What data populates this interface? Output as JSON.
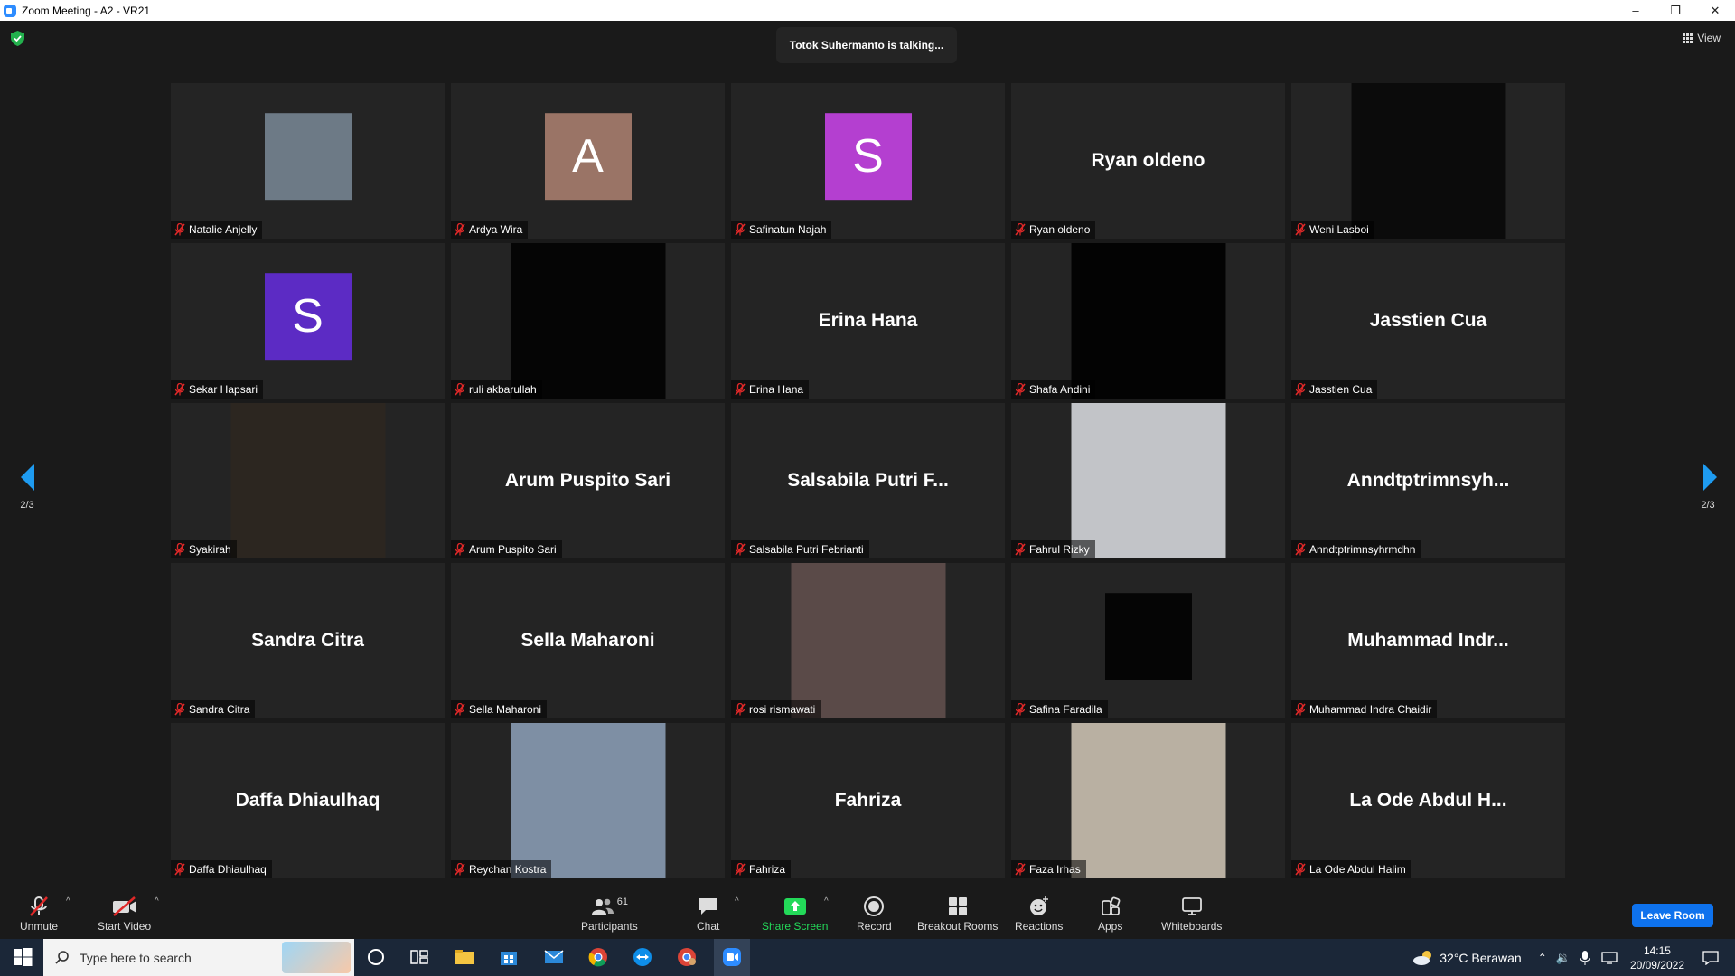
{
  "window": {
    "title": "Zoom Meeting - A2 - VR21",
    "minimize": "–",
    "restore": "❐",
    "close": "✕"
  },
  "meeting": {
    "talking": "Totok Suhermanto is talking...",
    "view_label": "View"
  },
  "pager": {
    "left": "2/3",
    "right": "2/3"
  },
  "tiles": [
    {
      "label": "Natalie Anjelly",
      "kind": "photo",
      "color": "#6d7a86"
    },
    {
      "label": "Ardya Wira",
      "kind": "avatar",
      "initial": "A",
      "color": "#9a7466"
    },
    {
      "label": "Safinatun Najah",
      "kind": "avatar",
      "initial": "S",
      "color": "#b43fd0"
    },
    {
      "label": "Ryan oldeno",
      "kind": "name",
      "name": "Ryan oldeno"
    },
    {
      "label": "Weni Lasboi",
      "kind": "video",
      "color": "#0b0b0b"
    },
    {
      "label": "Sekar Hapsari",
      "kind": "avatar",
      "initial": "S",
      "color": "#5c2bc4"
    },
    {
      "label": "ruli akbarullah",
      "kind": "video",
      "color": "#050505"
    },
    {
      "label": "Erina Hana",
      "kind": "name",
      "name": "Erina Hana"
    },
    {
      "label": "Shafa Andini",
      "kind": "video",
      "color": "#030303"
    },
    {
      "label": "Jasstien Cua",
      "kind": "name",
      "name": "Jasstien Cua"
    },
    {
      "label": "Syakirah",
      "kind": "video",
      "color": "#2c2620"
    },
    {
      "label": "Arum Puspito Sari",
      "kind": "name",
      "name": "Arum Puspito Sari"
    },
    {
      "label": "Salsabila Putri Febrianti",
      "kind": "name",
      "name": "Salsabila Putri F..."
    },
    {
      "label": "Fahrul Rizky",
      "kind": "video",
      "color": "#c2c4c8"
    },
    {
      "label": "Anndtptrimnsyhrmdhn",
      "kind": "name",
      "name": "Anndtptrimnsyh..."
    },
    {
      "label": "Sandra Citra",
      "kind": "name",
      "name": "Sandra Citra"
    },
    {
      "label": "Sella Maharoni",
      "kind": "name",
      "name": "Sella Maharoni"
    },
    {
      "label": "rosi rismawati",
      "kind": "video",
      "color": "#5a4a48"
    },
    {
      "label": "Safina Faradila",
      "kind": "photo",
      "color": "#050505"
    },
    {
      "label": "Muhammad Indra Chaidir",
      "kind": "name",
      "name": "Muhammad Indr..."
    },
    {
      "label": "Daffa Dhiaulhaq",
      "kind": "name",
      "name": "Daffa Dhiaulhaq"
    },
    {
      "label": "Reychan Kostra",
      "kind": "video",
      "color": "#7e8fa4"
    },
    {
      "label": "Fahriza",
      "kind": "name",
      "name": "Fahriza"
    },
    {
      "label": "Faza Irhas",
      "kind": "video",
      "color": "#b9b0a2"
    },
    {
      "label": "La Ode Abdul Halim",
      "kind": "name",
      "name": "La Ode Abdul H..."
    }
  ],
  "toolbar": {
    "unmute": "Unmute",
    "start_video": "Start Video",
    "participants": "Participants",
    "participants_count": "61",
    "chat": "Chat",
    "share_screen": "Share Screen",
    "record": "Record",
    "breakout_rooms": "Breakout Rooms",
    "reactions": "Reactions",
    "apps": "Apps",
    "whiteboards": "Whiteboards",
    "leave": "Leave Room"
  },
  "taskbar": {
    "search_placeholder": "Type here to search",
    "weather": "32°C  Berawan",
    "time": "14:15",
    "date": "20/09/2022"
  },
  "colors": {
    "accent": "#0e72ed",
    "share_green": "#23d959",
    "mute_red": "#e02828",
    "nav_blue": "#1e9bf0"
  }
}
